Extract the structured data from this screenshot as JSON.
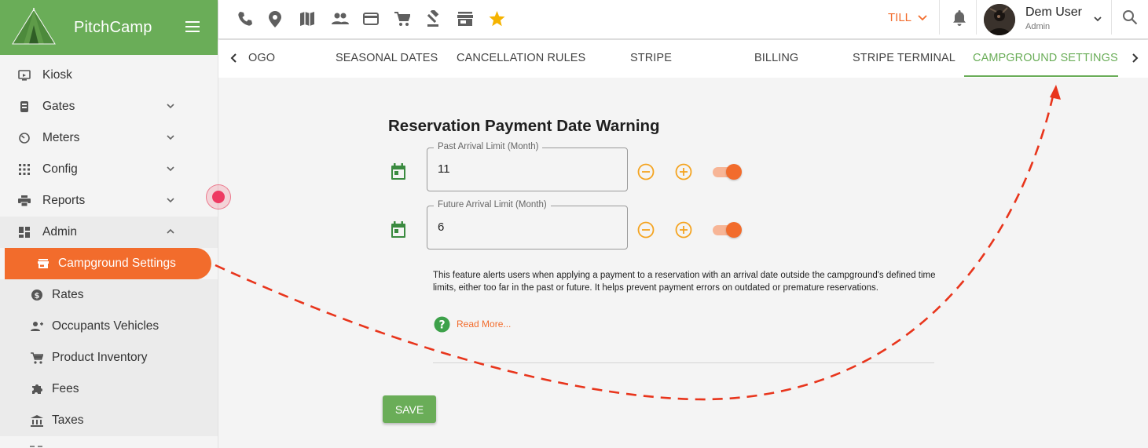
{
  "app": {
    "name": "PitchCamp"
  },
  "sidebar": {
    "items": [
      {
        "label": "Kiosk",
        "icon": "kiosk-icon"
      },
      {
        "label": "Gates",
        "icon": "gates-icon",
        "expandable": true
      },
      {
        "label": "Meters",
        "icon": "meters-icon",
        "expandable": true
      },
      {
        "label": "Config",
        "icon": "config-icon",
        "expandable": true
      },
      {
        "label": "Reports",
        "icon": "printer-icon",
        "expandable": true
      },
      {
        "label": "Admin",
        "icon": "dashboard-icon",
        "expandable": true,
        "expanded": true
      }
    ],
    "admin_sub": [
      {
        "label": "Campground Settings",
        "icon": "store-icon",
        "active": true
      },
      {
        "label": "Rates",
        "icon": "dollar-icon"
      },
      {
        "label": "Occupants Vehicles",
        "icon": "add-person-icon"
      },
      {
        "label": "Product Inventory",
        "icon": "cart-icon"
      },
      {
        "label": "Fees",
        "icon": "puzzle-icon"
      },
      {
        "label": "Taxes",
        "icon": "bank-icon"
      }
    ]
  },
  "topbar": {
    "icons": [
      "phone-icon",
      "location-pin-icon",
      "map-icon",
      "people-icon",
      "credit-card-icon",
      "cart-icon",
      "gavel-icon",
      "store-icon",
      "star-icon"
    ],
    "till_label": "TILL",
    "user_name": "Dem User",
    "user_role": "Admin"
  },
  "tabs": {
    "items": [
      "OGO",
      "SEASONAL DATES",
      "CANCELLATION RULES",
      "STRIPE",
      "BILLING",
      "STRIPE TERMINAL",
      "CAMPGROUND SETTINGS"
    ],
    "active": "CAMPGROUND SETTINGS"
  },
  "main": {
    "title": "Reservation Payment Date Warning",
    "past_label": "Past Arrival Limit (Month)",
    "past_value": "11",
    "past_enabled": true,
    "future_label": "Future Arrival Limit (Month)",
    "future_value": "6",
    "future_enabled": true,
    "description": "This feature alerts users when applying a payment to a reservation with an arrival date outside the campground's defined time limits, either too far in the past or future. It helps prevent payment errors on outdated or premature reservations.",
    "read_more": "Read More...",
    "save_label": "SAVE"
  },
  "colors": {
    "brand_green": "#6aad58",
    "accent_orange": "#f26c2c",
    "amber": "#f4a421",
    "star": "#f5b300",
    "annotation_red": "#e8351c"
  }
}
